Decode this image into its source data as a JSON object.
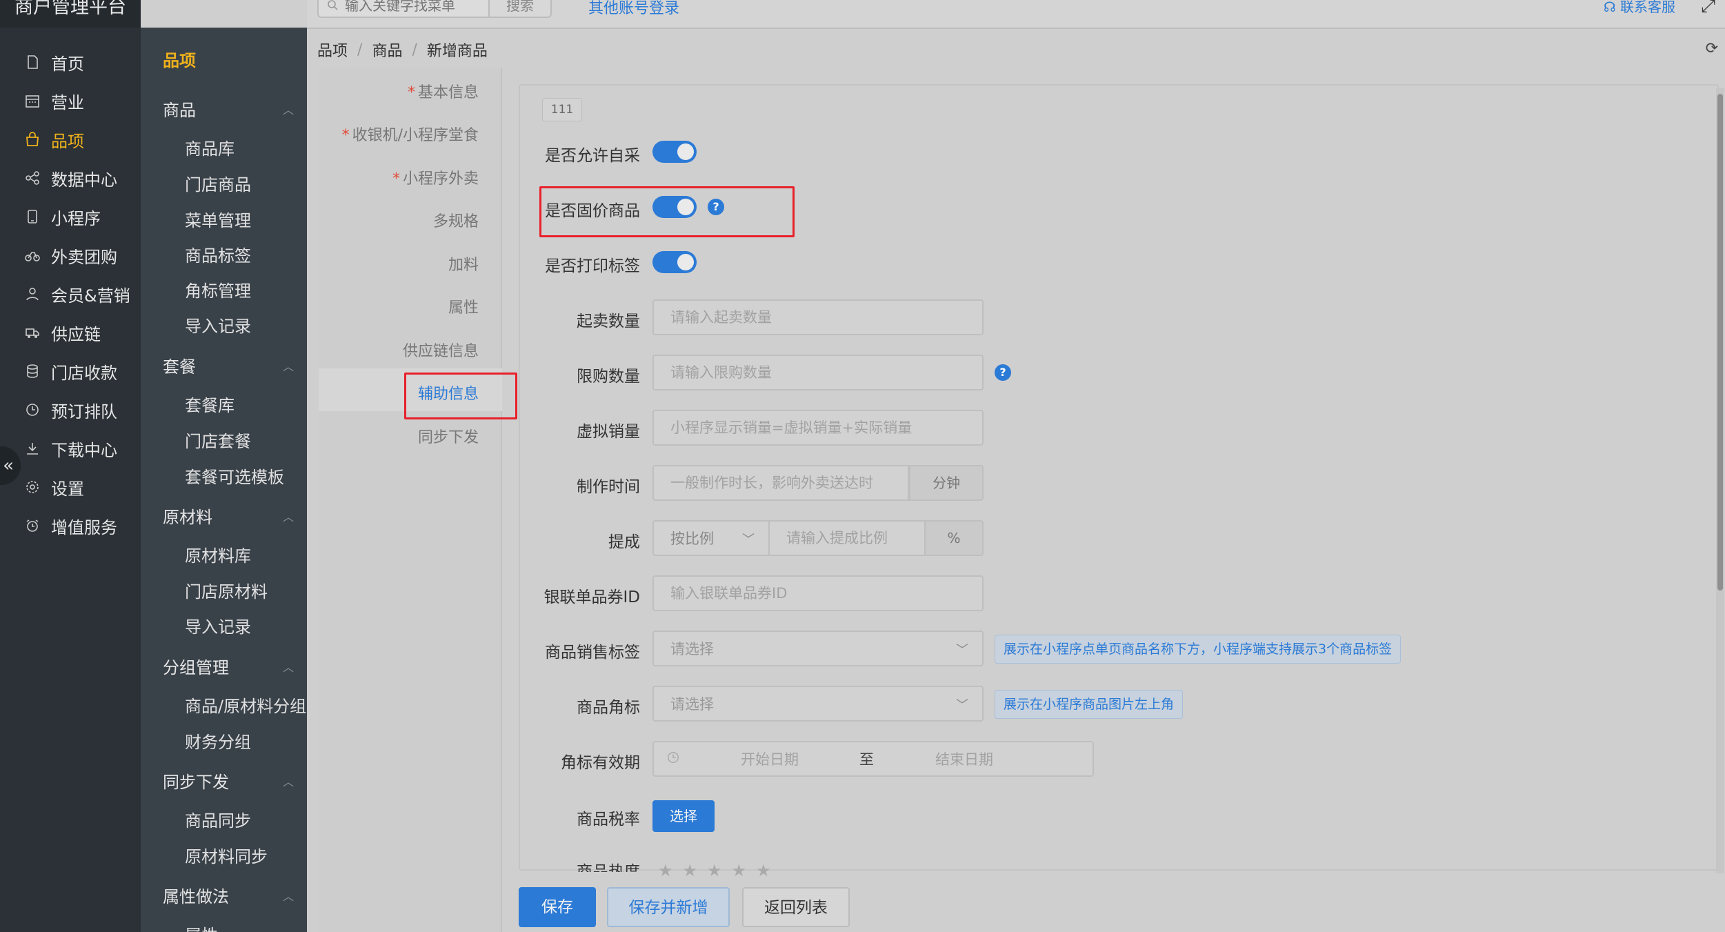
{
  "app": {
    "brand": "商户管理平台"
  },
  "nav1": {
    "items": [
      {
        "label": "首页",
        "icon": "file-icon"
      },
      {
        "label": "营业",
        "icon": "calendar-icon"
      },
      {
        "label": "品项",
        "icon": "bag-icon"
      },
      {
        "label": "数据中心",
        "icon": "share-icon"
      },
      {
        "label": "小程序",
        "icon": "phone-icon"
      },
      {
        "label": "外卖团购",
        "icon": "bike-icon"
      },
      {
        "label": "会员&营销",
        "icon": "user-icon"
      },
      {
        "label": "供应链",
        "icon": "truck-icon"
      },
      {
        "label": "门店收款",
        "icon": "database-icon"
      },
      {
        "label": "预订排队",
        "icon": "clock-icon"
      },
      {
        "label": "下载中心",
        "icon": "download-icon"
      },
      {
        "label": "设置",
        "icon": "gear-icon"
      },
      {
        "label": "增值服务",
        "icon": "alarm-icon"
      }
    ],
    "active": "品项"
  },
  "nav2": {
    "title": "品项",
    "groups": [
      {
        "label": "商品",
        "items": [
          "商品库",
          "门店商品",
          "菜单管理",
          "商品标签",
          "角标管理",
          "导入记录"
        ]
      },
      {
        "label": "套餐",
        "items": [
          "套餐库",
          "门店套餐",
          "套餐可选模板"
        ]
      },
      {
        "label": "原材料",
        "items": [
          "原材料库",
          "门店原材料",
          "导入记录"
        ]
      },
      {
        "label": "分组管理",
        "items": [
          "商品/原材料分组",
          "财务分组"
        ]
      },
      {
        "label": "同步下发",
        "items": [
          "商品同步",
          "原材料同步"
        ]
      },
      {
        "label": "属性做法",
        "items": [
          "属性"
        ]
      }
    ]
  },
  "topbar": {
    "search_placeholder": "输入关键字找菜单",
    "search_button": "搜索",
    "other_login": "其他账号登录",
    "contact": "联系客服"
  },
  "breadcrumb": [
    "品项",
    "商品",
    "新增商品"
  ],
  "steps": [
    {
      "label": "基本信息",
      "required": true
    },
    {
      "label": "收银机/小程序堂食",
      "required": true
    },
    {
      "label": "小程序外卖",
      "required": true
    },
    {
      "label": "多规格",
      "required": false
    },
    {
      "label": "加料",
      "required": false
    },
    {
      "label": "属性",
      "required": false
    },
    {
      "label": "供应链信息",
      "required": false
    },
    {
      "label": "辅助信息",
      "required": false
    },
    {
      "label": "同步下发",
      "required": false
    }
  ],
  "active_step": "辅助信息",
  "required_mark": "*",
  "form": {
    "tag": "111",
    "allow_self_purchase": {
      "label": "是否允许自采",
      "on": true
    },
    "fixed_price": {
      "label": "是否固价商品",
      "on": true
    },
    "print_label": {
      "label": "是否打印标签",
      "on": true
    },
    "min_qty": {
      "label": "起卖数量",
      "placeholder": "请输入起卖数量"
    },
    "limit_qty": {
      "label": "限购数量",
      "placeholder": "请输入限购数量"
    },
    "virtual_sales": {
      "label": "虚拟销量",
      "placeholder": "小程序显示销量=虚拟销量+实际销量"
    },
    "prep_time": {
      "label": "制作时间",
      "placeholder": "一般制作时长，影响外卖送达时",
      "unit": "分钟"
    },
    "commission": {
      "label": "提成",
      "mode": "按比例",
      "placeholder": "请输入提成比例",
      "unit": "%"
    },
    "unionpay_id": {
      "label": "银联单品券ID",
      "placeholder": "输入银联单品券ID"
    },
    "sales_tag": {
      "label": "商品销售标签",
      "placeholder": "请选择",
      "hint": "展示在小程序点单页商品名称下方，小程序端支持展示3个商品标签"
    },
    "corner_tag": {
      "label": "商品角标",
      "placeholder": "请选择",
      "hint": "展示在小程序商品图片左上角"
    },
    "corner_validity": {
      "label": "角标有效期",
      "start": "开始日期",
      "to": "至",
      "end": "结束日期"
    },
    "tax_rate": {
      "label": "商品税率",
      "button": "选择"
    },
    "heat": {
      "label": "商品热度",
      "stars": "★★★★★"
    }
  },
  "actions": {
    "save": "保存",
    "save_new": "保存并新增",
    "back": "返回列表"
  },
  "colors": {
    "accent": "#2b7ad6",
    "active_nav": "#f0b21c",
    "highlight": "#e8202a"
  }
}
